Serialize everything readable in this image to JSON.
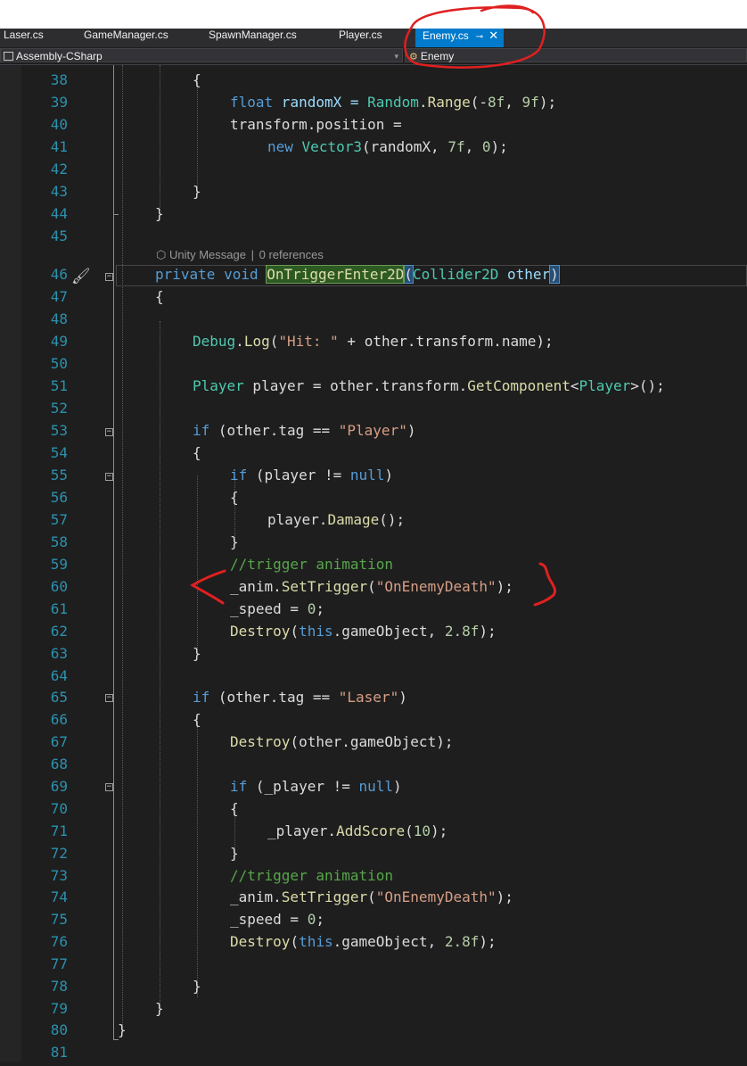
{
  "tabs": [
    {
      "label": "Laser.cs",
      "active": false
    },
    {
      "label": "GameManager.cs",
      "active": false
    },
    {
      "label": "SpawnManager.cs",
      "active": false
    },
    {
      "label": "Player.cs",
      "active": false
    },
    {
      "label": "Enemy.cs",
      "active": true,
      "pin_icon": "pin-icon",
      "close_icon": "close-icon"
    }
  ],
  "nav": {
    "project": "Assembly-CSharp",
    "type": "Enemy",
    "project_icon": "project-icon",
    "type_icon": "class-icon"
  },
  "codelens": {
    "message": "Unity Message",
    "separator": "|",
    "references": "0 references"
  },
  "lines": [
    {
      "n": "38"
    },
    {
      "n": "39"
    },
    {
      "n": "40"
    },
    {
      "n": "41"
    },
    {
      "n": "42"
    },
    {
      "n": "43"
    },
    {
      "n": "44"
    },
    {
      "n": "45"
    },
    {
      "n": "46"
    },
    {
      "n": "47"
    },
    {
      "n": "48"
    },
    {
      "n": "49"
    },
    {
      "n": "50"
    },
    {
      "n": "51"
    },
    {
      "n": "52"
    },
    {
      "n": "53"
    },
    {
      "n": "54"
    },
    {
      "n": "55"
    },
    {
      "n": "56"
    },
    {
      "n": "57"
    },
    {
      "n": "58"
    },
    {
      "n": "59"
    },
    {
      "n": "60"
    },
    {
      "n": "61"
    },
    {
      "n": "62"
    },
    {
      "n": "63"
    },
    {
      "n": "64"
    },
    {
      "n": "65"
    },
    {
      "n": "66"
    },
    {
      "n": "67"
    },
    {
      "n": "68"
    },
    {
      "n": "69"
    },
    {
      "n": "70"
    },
    {
      "n": "71"
    },
    {
      "n": "72"
    },
    {
      "n": "73"
    },
    {
      "n": "74"
    },
    {
      "n": "75"
    },
    {
      "n": "76"
    },
    {
      "n": "77"
    },
    {
      "n": "78"
    },
    {
      "n": "79"
    },
    {
      "n": "80"
    },
    {
      "n": "81"
    }
  ],
  "code": {
    "l38": "{",
    "l39a": "float",
    "l39b": " randomX = ",
    "l39c": "Random",
    "l39d": ".",
    "l39e": "Range",
    "l39f": "(-",
    "l39g": "8f",
    "l39h": ", ",
    "l39i": "9f",
    "l39j": ");",
    "l40": "transform.position =",
    "l41a": "new",
    "l41b": " ",
    "l41c": "Vector3",
    "l41d": "(randomX, ",
    "l41e": "7f",
    "l41f": ", ",
    "l41g": "0",
    "l41h": ");",
    "l43": "}",
    "l44": "}",
    "l46a": "private",
    "l46b": " ",
    "l46c": "void",
    "l46d": " ",
    "l46e": "OnTriggerEnter2D",
    "l46f": "(",
    "l46g": "Collider2D",
    "l46h": " other",
    "l46i": ")",
    "l47": "{",
    "l49a": "Debug",
    "l49b": ".",
    "l49c": "Log",
    "l49d": "(",
    "l49e": "\"Hit: \"",
    "l49f": " + other.transform.name);",
    "l51a": "Player",
    "l51b": " player = other.transform.",
    "l51c": "GetComponent",
    "l51d": "<",
    "l51e": "Player",
    "l51f": ">();",
    "l53a": "if",
    "l53b": " (other.tag == ",
    "l53c": "\"Player\"",
    "l53d": ")",
    "l54": "{",
    "l55a": "if",
    "l55b": " (player != ",
    "l55c": "null",
    "l55d": ")",
    "l56": "{",
    "l57a": "player.",
    "l57b": "Damage",
    "l57c": "();",
    "l58": "}",
    "l59": "//trigger animation",
    "l60a": "_anim.",
    "l60b": "SetTrigger",
    "l60c": "(",
    "l60d": "\"OnEnemyDeath\"",
    "l60e": ");",
    "l61a": "_speed = ",
    "l61b": "0",
    "l61c": ";",
    "l62a": "Destroy",
    "l62b": "(",
    "l62c": "this",
    "l62d": ".gameObject, ",
    "l62e": "2.8f",
    "l62f": ");",
    "l63": "}",
    "l65a": "if",
    "l65b": " (other.tag == ",
    "l65c": "\"Laser\"",
    "l65d": ")",
    "l66": "{",
    "l67a": "Destroy",
    "l67b": "(other.gameObject);",
    "l69a": "if",
    "l69b": " (_player != ",
    "l69c": "null",
    "l69d": ")",
    "l70": "{",
    "l71a": "_player.",
    "l71b": "AddScore",
    "l71c": "(",
    "l71d": "10",
    "l71e": ");",
    "l72": "}",
    "l73": "//trigger animation",
    "l74a": "_anim.",
    "l74b": "SetTrigger",
    "l74c": "(",
    "l74d": "\"OnEnemyDeath\"",
    "l74e": ");",
    "l75a": "_speed = ",
    "l75b": "0",
    "l75c": ";",
    "l76a": "Destroy",
    "l76b": "(",
    "l76c": "this",
    "l76d": ".gameObject, ",
    "l76e": "2.8f",
    "l76f": ");",
    "l78": "}",
    "l79": "}",
    "l80": "}"
  },
  "colors": {
    "keyword": "#569cd6",
    "type": "#4ec9b0",
    "method": "#dcdcaa",
    "string": "#d69d85",
    "number": "#b5cea8",
    "comment": "#57a64a",
    "line_number": "#2b91af",
    "annotation": "#e02020",
    "active_tab": "#007acc"
  },
  "annotations": {
    "tab_circle": "red hand-drawn circle around Enemy.cs tab",
    "line60_brackets": "red hand-drawn angle brackets around line 60"
  }
}
